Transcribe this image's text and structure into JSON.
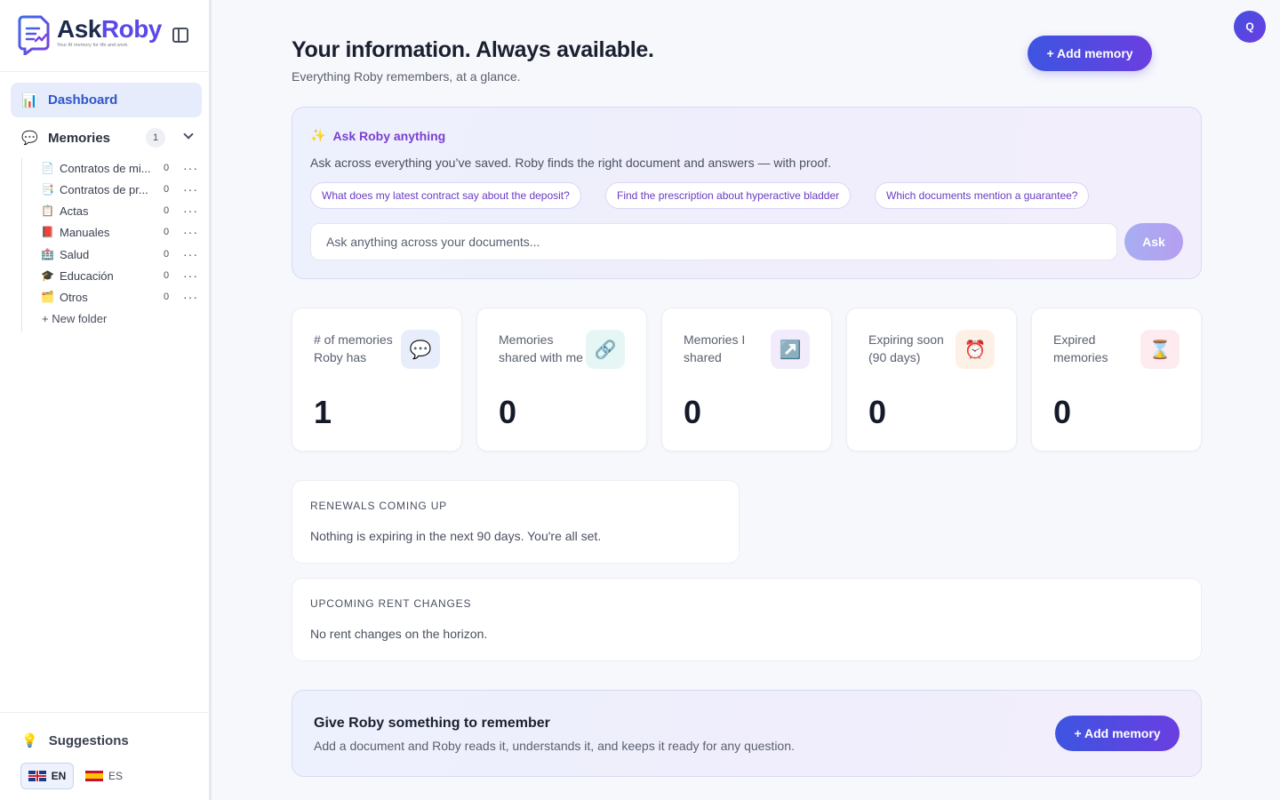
{
  "brand": {
    "name_part1": "Ask",
    "name_part2": "Roby",
    "tagline": "Your AI memory for life and work."
  },
  "sidebar": {
    "dashboard_label": "Dashboard",
    "dashboard_icon": "bar-chart-icon",
    "memories_label": "Memories",
    "memories_count": "1",
    "folders": [
      {
        "icon": "📄",
        "name": "Contratos de mi...",
        "count": "0"
      },
      {
        "icon": "📑",
        "name": "Contratos de pr...",
        "count": "0"
      },
      {
        "icon": "📋",
        "name": "Actas",
        "count": "0"
      },
      {
        "icon": "📕",
        "name": "Manuales",
        "count": "0"
      },
      {
        "icon": "🏥",
        "name": "Salud",
        "count": "0"
      },
      {
        "icon": "🎓",
        "name": "Educación",
        "count": "0"
      },
      {
        "icon": "🗂️",
        "name": "Otros",
        "count": "0"
      }
    ],
    "more_glyph": "···",
    "new_folder_label": "+ New folder",
    "suggestions_label": "Suggestions",
    "lang_en": "EN",
    "lang_es": "ES"
  },
  "header": {
    "title": "Your information. Always available.",
    "subtitle": "Everything Roby remembers, at a glance.",
    "add_memory_label": "+ Add memory",
    "avatar_initial": "Q"
  },
  "ask": {
    "title": "Ask Roby anything",
    "description": "Ask across everything you’ve saved. Roby finds the right document and answers — with proof.",
    "chips": [
      "What does my latest contract say about the deposit?",
      "Find the prescription about hyperactive bladder",
      "Which documents mention a guarantee?"
    ],
    "input_placeholder": "Ask anything across your documents...",
    "ask_button": "Ask"
  },
  "stats": [
    {
      "label": "# of memories Roby has",
      "value": "1",
      "icon": "💬",
      "icon_bg": "#e8edfb"
    },
    {
      "label": "Memories shared with me",
      "value": "0",
      "icon": "🔗",
      "icon_bg": "#e5f6f4"
    },
    {
      "label": "Memories I shared",
      "value": "0",
      "icon": "↗️",
      "icon_bg": "#f1ebfb"
    },
    {
      "label": "Expiring soon (90 days)",
      "value": "0",
      "icon": "⏰",
      "icon_bg": "#fdf0e6"
    },
    {
      "label": "Expired memories",
      "value": "0",
      "icon": "⌛",
      "icon_bg": "#fdebef"
    }
  ],
  "renewals": {
    "title": "RENEWALS COMING UP",
    "text": "Nothing is expiring in the next 90 days. You're all set."
  },
  "rent": {
    "title": "UPCOMING RENT CHANGES",
    "text": "No rent changes on the horizon."
  },
  "cta": {
    "title": "Give Roby something to remember",
    "text": "Add a document and Roby reads it, understands it, and keeps it ready for any question.",
    "button": "+ Add memory"
  }
}
